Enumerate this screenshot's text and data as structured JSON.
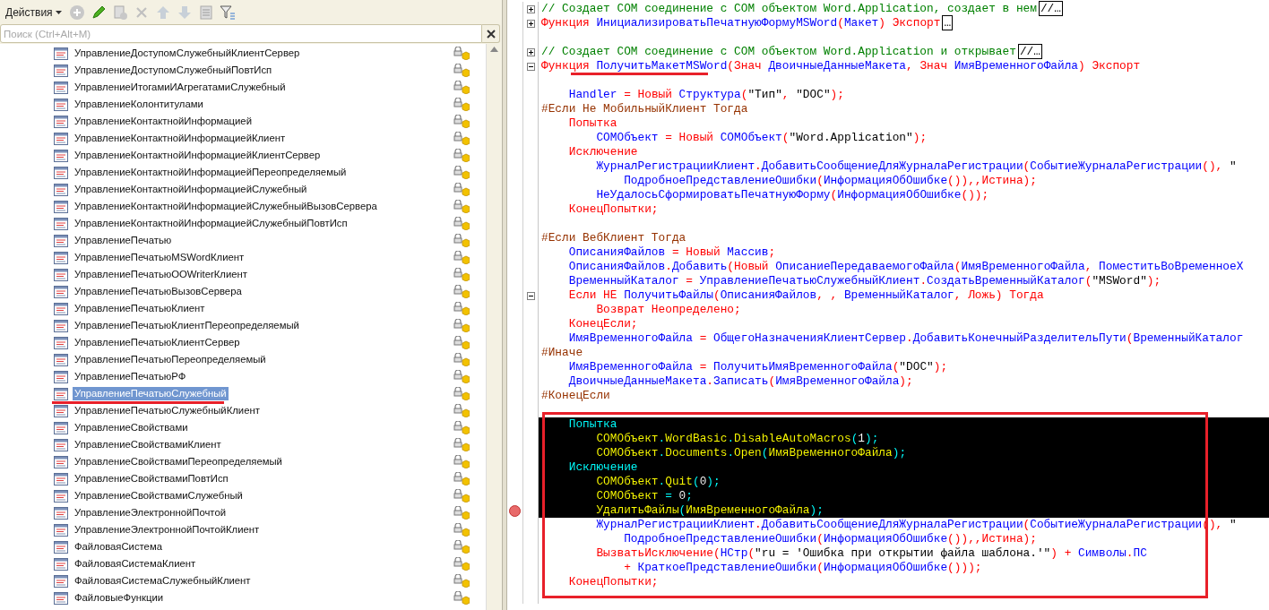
{
  "toolbar": {
    "actions_label": "Действия"
  },
  "search": {
    "placeholder": "Поиск (Ctrl+Alt+M)"
  },
  "modules": [
    {
      "label": "УправлениеДоступомСлужебныйКлиентСервер",
      "selected": false
    },
    {
      "label": "УправлениеДоступомСлужебныйПовтИсп",
      "selected": false
    },
    {
      "label": "УправлениеИтогамиИАгрегатамиСлужебный",
      "selected": false
    },
    {
      "label": "УправлениеКолонтитулами",
      "selected": false
    },
    {
      "label": "УправлениеКонтактнойИнформацией",
      "selected": false
    },
    {
      "label": "УправлениеКонтактнойИнформациейКлиент",
      "selected": false
    },
    {
      "label": "УправлениеКонтактнойИнформациейКлиентСервер",
      "selected": false
    },
    {
      "label": "УправлениеКонтактнойИнформациейПереопределяемый",
      "selected": false
    },
    {
      "label": "УправлениеКонтактнойИнформациейСлужебный",
      "selected": false
    },
    {
      "label": "УправлениеКонтактнойИнформациейСлужебныйВызовСервера",
      "selected": false
    },
    {
      "label": "УправлениеКонтактнойИнформациейСлужебныйПовтИсп",
      "selected": false
    },
    {
      "label": "УправлениеПечатью",
      "selected": false
    },
    {
      "label": "УправлениеПечатьюMSWordКлиент",
      "selected": false
    },
    {
      "label": "УправлениеПечатьюOOWriterКлиент",
      "selected": false
    },
    {
      "label": "УправлениеПечатьюВызовСервера",
      "selected": false
    },
    {
      "label": "УправлениеПечатьюКлиент",
      "selected": false
    },
    {
      "label": "УправлениеПечатьюКлиентПереопределяемый",
      "selected": false
    },
    {
      "label": "УправлениеПечатьюКлиентСервер",
      "selected": false
    },
    {
      "label": "УправлениеПечатьюПереопределяемый",
      "selected": false
    },
    {
      "label": "УправлениеПечатьюРФ",
      "selected": false
    },
    {
      "label": "УправлениеПечатьюСлужебный",
      "selected": true
    },
    {
      "label": "УправлениеПечатьюСлужебныйКлиент",
      "selected": false
    },
    {
      "label": "УправлениеСвойствами",
      "selected": false
    },
    {
      "label": "УправлениеСвойствамиКлиент",
      "selected": false
    },
    {
      "label": "УправлениеСвойствамиПереопределяемый",
      "selected": false
    },
    {
      "label": "УправлениеСвойствамиПовтИсп",
      "selected": false
    },
    {
      "label": "УправлениеСвойствамиСлужебный",
      "selected": false
    },
    {
      "label": "УправлениеЭлектроннойПочтой",
      "selected": false
    },
    {
      "label": "УправлениеЭлектроннойПочтойКлиент",
      "selected": false
    },
    {
      "label": "ФайловаяСистема",
      "selected": false
    },
    {
      "label": "ФайловаяСистемаКлиент",
      "selected": false
    },
    {
      "label": "ФайловаяСистемаСлужебныйКлиент",
      "selected": false
    },
    {
      "label": "ФайловыеФункции",
      "selected": false
    }
  ],
  "code_lines": [
    {
      "kind": "collapsed",
      "selected": false,
      "breakpoint": false,
      "tokens": [
        {
          "kind": "comment",
          "text": "// Создает COM соединение с COM объектом Word.Application, создает в нем"
        },
        {
          "kind": "fold",
          "text": "//…"
        }
      ]
    },
    {
      "kind": "collapsed",
      "selected": false,
      "breakpoint": false,
      "tokens": [
        {
          "kind": "keyword",
          "text": "Функция "
        },
        {
          "kind": "name",
          "text": "ИнициализироватьПечатнуюФормуMSWord"
        },
        {
          "kind": "keyword",
          "text": "("
        },
        {
          "kind": "name",
          "text": "Макет"
        },
        {
          "kind": "keyword",
          "text": ") Экспорт"
        },
        {
          "kind": "fold",
          "text": "…"
        }
      ]
    },
    {
      "kind": "plain",
      "selected": false,
      "breakpoint": false
    },
    {
      "kind": "collapsed",
      "selected": false,
      "breakpoint": false,
      "tokens": [
        {
          "kind": "comment",
          "text": "// Создает COM соединение с COM объектом Word.Application и открывает"
        },
        {
          "kind": "fold",
          "text": "//…"
        }
      ]
    },
    {
      "kind": "expanded",
      "selected": false,
      "breakpoint": false,
      "tokens": [
        {
          "kind": "keyword",
          "text": "Функция "
        },
        {
          "kind": "name",
          "text": "ПолучитьМакетMSWord"
        },
        {
          "kind": "keyword",
          "text": "(Знач "
        },
        {
          "kind": "name",
          "text": "ДвоичныеДанныеМакета"
        },
        {
          "kind": "keyword",
          "text": ", Знач "
        },
        {
          "kind": "name",
          "text": "ИмяВременногоФайла"
        },
        {
          "kind": "keyword",
          "text": ") Экспорт"
        }
      ]
    },
    {
      "kind": "plain",
      "selected": false,
      "breakpoint": false
    },
    {
      "kind": "plain",
      "selected": false,
      "breakpoint": false,
      "tokens": [
        {
          "kind": "name",
          "text": "    Handler"
        },
        {
          "kind": "keyword",
          "text": " = Новый "
        },
        {
          "kind": "name",
          "text": "Структура"
        },
        {
          "kind": "keyword",
          "text": "("
        },
        {
          "kind": "string",
          "text": "\"Тип\""
        },
        {
          "kind": "keyword",
          "text": ", "
        },
        {
          "kind": "string",
          "text": "\"DOC\""
        },
        {
          "kind": "keyword",
          "text": ");"
        }
      ]
    },
    {
      "kind": "plain",
      "selected": false,
      "breakpoint": false,
      "tokens": [
        {
          "kind": "directive",
          "text": "#Если Не МобильныйКлиент Тогда"
        }
      ]
    },
    {
      "kind": "plain",
      "selected": false,
      "breakpoint": false,
      "tokens": [
        {
          "kind": "keyword",
          "text": "    Попытка"
        }
      ]
    },
    {
      "kind": "plain",
      "selected": false,
      "breakpoint": false,
      "tokens": [
        {
          "kind": "name",
          "text": "        СОМОбъект"
        },
        {
          "kind": "keyword",
          "text": " = Новый "
        },
        {
          "kind": "name",
          "text": "СОМОбъект"
        },
        {
          "kind": "keyword",
          "text": "("
        },
        {
          "kind": "string",
          "text": "\"Word.Application\""
        },
        {
          "kind": "keyword",
          "text": ");"
        }
      ]
    },
    {
      "kind": "plain",
      "selected": false,
      "breakpoint": false,
      "tokens": [
        {
          "kind": "keyword",
          "text": "    Исключение"
        }
      ]
    },
    {
      "kind": "plain",
      "selected": false,
      "breakpoint": false,
      "tokens": [
        {
          "kind": "name",
          "text": "        ЖурналРегистрацииКлиент"
        },
        {
          "kind": "keyword",
          "text": "."
        },
        {
          "kind": "name",
          "text": "ДобавитьСообщениеДляЖурналаРегистрации"
        },
        {
          "kind": "keyword",
          "text": "("
        },
        {
          "kind": "name",
          "text": "СобытиеЖурналаРегистрации"
        },
        {
          "kind": "keyword",
          "text": "(), "
        },
        {
          "kind": "string",
          "text": "\""
        }
      ]
    },
    {
      "kind": "plain",
      "selected": false,
      "breakpoint": false,
      "tokens": [
        {
          "kind": "name",
          "text": "            ПодробноеПредставлениеОшибки"
        },
        {
          "kind": "keyword",
          "text": "("
        },
        {
          "kind": "name",
          "text": "ИнформацияОбОшибке"
        },
        {
          "kind": "keyword",
          "text": "()),,Истина);"
        }
      ]
    },
    {
      "kind": "plain",
      "selected": false,
      "breakpoint": false,
      "tokens": [
        {
          "kind": "name",
          "text": "        НеУдалосьСформироватьПечатнуюФорму"
        },
        {
          "kind": "keyword",
          "text": "("
        },
        {
          "kind": "name",
          "text": "ИнформацияОбОшибке"
        },
        {
          "kind": "keyword",
          "text": "());"
        }
      ]
    },
    {
      "kind": "plain",
      "selected": false,
      "breakpoint": false,
      "tokens": [
        {
          "kind": "keyword",
          "text": "    КонецПопытки;"
        }
      ]
    },
    {
      "kind": "plain",
      "selected": false,
      "breakpoint": false
    },
    {
      "kind": "plain",
      "selected": false,
      "breakpoint": false,
      "tokens": [
        {
          "kind": "directive",
          "text": "#Если ВебКлиент Тогда"
        }
      ]
    },
    {
      "kind": "plain",
      "selected": false,
      "breakpoint": false,
      "tokens": [
        {
          "kind": "name",
          "text": "    ОписанияФайлов"
        },
        {
          "kind": "keyword",
          "text": " = Новый "
        },
        {
          "kind": "name",
          "text": "Массив"
        },
        {
          "kind": "keyword",
          "text": ";"
        }
      ]
    },
    {
      "kind": "plain",
      "selected": false,
      "breakpoint": false,
      "tokens": [
        {
          "kind": "name",
          "text": "    ОписанияФайлов"
        },
        {
          "kind": "keyword",
          "text": "."
        },
        {
          "kind": "name",
          "text": "Добавить"
        },
        {
          "kind": "keyword",
          "text": "(Новый "
        },
        {
          "kind": "name",
          "text": "ОписаниеПередаваемогоФайла"
        },
        {
          "kind": "keyword",
          "text": "("
        },
        {
          "kind": "name",
          "text": "ИмяВременногоФайла"
        },
        {
          "kind": "keyword",
          "text": ", "
        },
        {
          "kind": "name",
          "text": "ПоместитьВоВременноеХ"
        }
      ]
    },
    {
      "kind": "plain",
      "selected": false,
      "breakpoint": false,
      "tokens": [
        {
          "kind": "name",
          "text": "    ВременныйКаталог"
        },
        {
          "kind": "keyword",
          "text": " = "
        },
        {
          "kind": "name",
          "text": "УправлениеПечатьюСлужебныйКлиент"
        },
        {
          "kind": "keyword",
          "text": "."
        },
        {
          "kind": "name",
          "text": "СоздатьВременныйКаталог"
        },
        {
          "kind": "keyword",
          "text": "("
        },
        {
          "kind": "string",
          "text": "\"MSWord\""
        },
        {
          "kind": "keyword",
          "text": ");"
        }
      ]
    },
    {
      "kind": "expanded",
      "selected": false,
      "breakpoint": false,
      "tokens": [
        {
          "kind": "keyword",
          "text": "    Если НЕ "
        },
        {
          "kind": "name",
          "text": "ПолучитьФайлы"
        },
        {
          "kind": "keyword",
          "text": "("
        },
        {
          "kind": "name",
          "text": "ОписанияФайлов"
        },
        {
          "kind": "keyword",
          "text": ", , "
        },
        {
          "kind": "name",
          "text": "ВременныйКаталог"
        },
        {
          "kind": "keyword",
          "text": ", Ложь) Тогда"
        }
      ]
    },
    {
      "kind": "plain",
      "selected": false,
      "breakpoint": false,
      "tokens": [
        {
          "kind": "keyword",
          "text": "        Возврат Неопределено;"
        }
      ]
    },
    {
      "kind": "plain",
      "selected": false,
      "breakpoint": false,
      "tokens": [
        {
          "kind": "keyword",
          "text": "    КонецЕсли;"
        }
      ]
    },
    {
      "kind": "plain",
      "selected": false,
      "breakpoint": false,
      "tokens": [
        {
          "kind": "name",
          "text": "    ИмяВременногоФайла"
        },
        {
          "kind": "keyword",
          "text": " = "
        },
        {
          "kind": "name",
          "text": "ОбщегоНазначенияКлиентСервер"
        },
        {
          "kind": "keyword",
          "text": "."
        },
        {
          "kind": "name",
          "text": "ДобавитьКонечныйРазделительПути"
        },
        {
          "kind": "keyword",
          "text": "("
        },
        {
          "kind": "name",
          "text": "ВременныйКаталог"
        }
      ]
    },
    {
      "kind": "plain",
      "selected": false,
      "breakpoint": false,
      "tokens": [
        {
          "kind": "directive",
          "text": "#Иначе"
        }
      ]
    },
    {
      "kind": "plain",
      "selected": false,
      "breakpoint": false,
      "tokens": [
        {
          "kind": "name",
          "text": "    ИмяВременногоФайла"
        },
        {
          "kind": "keyword",
          "text": " = "
        },
        {
          "kind": "name",
          "text": "ПолучитьИмяВременногоФайла"
        },
        {
          "kind": "keyword",
          "text": "("
        },
        {
          "kind": "string",
          "text": "\"DOC\""
        },
        {
          "kind": "keyword",
          "text": ");"
        }
      ]
    },
    {
      "kind": "plain",
      "selected": false,
      "breakpoint": false,
      "tokens": [
        {
          "kind": "name",
          "text": "    ДвоичныеДанныеМакета"
        },
        {
          "kind": "keyword",
          "text": "."
        },
        {
          "kind": "name",
          "text": "Записать"
        },
        {
          "kind": "keyword",
          "text": "("
        },
        {
          "kind": "name",
          "text": "ИмяВременногоФайла"
        },
        {
          "kind": "keyword",
          "text": ");"
        }
      ]
    },
    {
      "kind": "plain",
      "selected": false,
      "breakpoint": false,
      "tokens": [
        {
          "kind": "directive",
          "text": "#КонецЕсли"
        }
      ]
    },
    {
      "kind": "plain",
      "selected": false,
      "breakpoint": false
    },
    {
      "kind": "plain",
      "selected": true,
      "breakpoint": false,
      "tokens": [
        {
          "kind": "keyword",
          "text": "    Попытка"
        }
      ]
    },
    {
      "kind": "plain",
      "selected": true,
      "breakpoint": false,
      "tokens": [
        {
          "kind": "name",
          "text": "        СОМОбъект"
        },
        {
          "kind": "keyword",
          "text": "."
        },
        {
          "kind": "name",
          "text": "WordBasic"
        },
        {
          "kind": "keyword",
          "text": "."
        },
        {
          "kind": "name",
          "text": "DisableAutoMacros"
        },
        {
          "kind": "keyword",
          "text": "("
        },
        {
          "kind": "string",
          "text": "1"
        },
        {
          "kind": "keyword",
          "text": ");"
        }
      ]
    },
    {
      "kind": "plain",
      "selected": true,
      "breakpoint": false,
      "tokens": [
        {
          "kind": "name",
          "text": "        СОМОбъект"
        },
        {
          "kind": "keyword",
          "text": "."
        },
        {
          "kind": "name",
          "text": "Documents"
        },
        {
          "kind": "keyword",
          "text": "."
        },
        {
          "kind": "name",
          "text": "Open"
        },
        {
          "kind": "keyword",
          "text": "("
        },
        {
          "kind": "name",
          "text": "ИмяВременногоФайла"
        },
        {
          "kind": "keyword",
          "text": ");"
        }
      ]
    },
    {
      "kind": "plain",
      "selected": true,
      "breakpoint": false,
      "tokens": [
        {
          "kind": "keyword",
          "text": "    Исключение"
        }
      ]
    },
    {
      "kind": "plain",
      "selected": true,
      "breakpoint": false,
      "tokens": [
        {
          "kind": "name",
          "text": "        СОМОбъект"
        },
        {
          "kind": "keyword",
          "text": "."
        },
        {
          "kind": "name",
          "text": "Quit"
        },
        {
          "kind": "keyword",
          "text": "("
        },
        {
          "kind": "string",
          "text": "0"
        },
        {
          "kind": "keyword",
          "text": ");"
        }
      ]
    },
    {
      "kind": "plain",
      "selected": true,
      "breakpoint": false,
      "tokens": [
        {
          "kind": "name",
          "text": "        СОМОбъект"
        },
        {
          "kind": "keyword",
          "text": " = "
        },
        {
          "kind": "string",
          "text": "0"
        },
        {
          "kind": "keyword",
          "text": ";"
        }
      ]
    },
    {
      "kind": "plain",
      "selected": true,
      "breakpoint": true,
      "tokens": [
        {
          "kind": "name",
          "text": "        УдалитьФайлы"
        },
        {
          "kind": "keyword",
          "text": "("
        },
        {
          "kind": "name",
          "text": "ИмяВременногоФайла"
        },
        {
          "kind": "keyword",
          "text": ");"
        }
      ]
    },
    {
      "kind": "plain",
      "selected": false,
      "breakpoint": false,
      "tokens": [
        {
          "kind": "name",
          "text": "        ЖурналРегистрацииКлиент"
        },
        {
          "kind": "keyword",
          "text": "."
        },
        {
          "kind": "name",
          "text": "ДобавитьСообщениеДляЖурналаРегистрации"
        },
        {
          "kind": "keyword",
          "text": "("
        },
        {
          "kind": "name",
          "text": "СобытиеЖурналаРегистрации"
        },
        {
          "kind": "keyword",
          "text": "(), "
        },
        {
          "kind": "string",
          "text": "\""
        }
      ]
    },
    {
      "kind": "plain",
      "selected": false,
      "breakpoint": false,
      "tokens": [
        {
          "kind": "name",
          "text": "            ПодробноеПредставлениеОшибки"
        },
        {
          "kind": "keyword",
          "text": "("
        },
        {
          "kind": "name",
          "text": "ИнформацияОбОшибке"
        },
        {
          "kind": "keyword",
          "text": "()),,Истина);"
        }
      ]
    },
    {
      "kind": "plain",
      "selected": false,
      "breakpoint": false,
      "tokens": [
        {
          "kind": "keyword",
          "text": "        ВызватьИсключение("
        },
        {
          "kind": "name",
          "text": "НСтр"
        },
        {
          "kind": "keyword",
          "text": "("
        },
        {
          "kind": "string",
          "text": "\"ru = 'Ошибка при открытии файла шаблона.'\""
        },
        {
          "kind": "keyword",
          "text": ") + "
        },
        {
          "kind": "name",
          "text": "Символы"
        },
        {
          "kind": "keyword",
          "text": "."
        },
        {
          "kind": "name",
          "text": "ПС"
        }
      ]
    },
    {
      "kind": "plain",
      "selected": false,
      "breakpoint": false,
      "tokens": [
        {
          "kind": "keyword",
          "text": "            + "
        },
        {
          "kind": "name",
          "text": "КраткоеПредставлениеОшибки"
        },
        {
          "kind": "keyword",
          "text": "("
        },
        {
          "kind": "name",
          "text": "ИнформацияОбОшибке"
        },
        {
          "kind": "keyword",
          "text": "()));"
        }
      ]
    },
    {
      "kind": "plain",
      "selected": false,
      "breakpoint": false,
      "tokens": [
        {
          "kind": "keyword",
          "text": "    КонецПопытки;"
        }
      ]
    },
    {
      "kind": "plain",
      "selected": false,
      "breakpoint": false
    }
  ]
}
